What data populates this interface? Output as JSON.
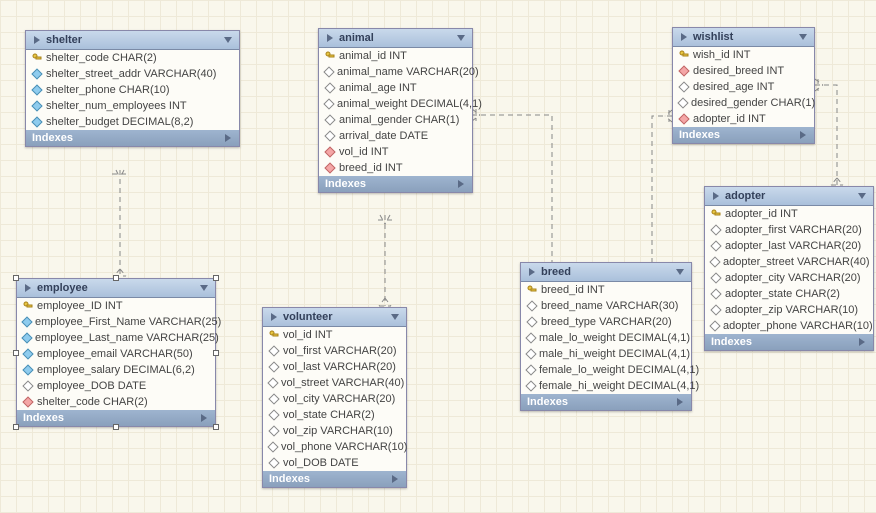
{
  "tables": {
    "shelter": {
      "title": "shelter",
      "columns": [
        {
          "icon": "key",
          "label": "shelter_code CHAR(2)"
        },
        {
          "icon": "blue",
          "label": "shelter_street_addr VARCHAR(40)"
        },
        {
          "icon": "blue",
          "label": "shelter_phone CHAR(10)"
        },
        {
          "icon": "blue",
          "label": "shelter_num_employees INT"
        },
        {
          "icon": "blue",
          "label": "shelter_budget DECIMAL(8,2)"
        }
      ],
      "footer": "Indexes"
    },
    "employee": {
      "title": "employee",
      "columns": [
        {
          "icon": "key",
          "label": "employee_ID INT"
        },
        {
          "icon": "blue",
          "label": "employee_First_Name VARCHAR(25)"
        },
        {
          "icon": "blue",
          "label": "employee_Last_name VARCHAR(25)"
        },
        {
          "icon": "blue",
          "label": "employee_email VARCHAR(50)"
        },
        {
          "icon": "blue",
          "label": "employee_salary DECIMAL(6,2)"
        },
        {
          "icon": "open",
          "label": "employee_DOB DATE"
        },
        {
          "icon": "red",
          "label": "shelter_code CHAR(2)"
        }
      ],
      "footer": "Indexes"
    },
    "animal": {
      "title": "animal",
      "columns": [
        {
          "icon": "key",
          "label": "animal_id INT"
        },
        {
          "icon": "open",
          "label": "animal_name VARCHAR(20)"
        },
        {
          "icon": "open",
          "label": "animal_age INT"
        },
        {
          "icon": "open",
          "label": "animal_weight DECIMAL(4,1)"
        },
        {
          "icon": "open",
          "label": "animal_gender CHAR(1)"
        },
        {
          "icon": "open",
          "label": "arrival_date DATE"
        },
        {
          "icon": "red",
          "label": "vol_id INT"
        },
        {
          "icon": "red",
          "label": "breed_id INT"
        }
      ],
      "footer": "Indexes"
    },
    "volunteer": {
      "title": "volunteer",
      "columns": [
        {
          "icon": "key",
          "label": "vol_id INT"
        },
        {
          "icon": "open",
          "label": "vol_first VARCHAR(20)"
        },
        {
          "icon": "open",
          "label": "vol_last VARCHAR(20)"
        },
        {
          "icon": "open",
          "label": "vol_street VARCHAR(40)"
        },
        {
          "icon": "open",
          "label": "vol_city VARCHAR(20)"
        },
        {
          "icon": "open",
          "label": "vol_state CHAR(2)"
        },
        {
          "icon": "open",
          "label": "vol_zip VARCHAR(10)"
        },
        {
          "icon": "open",
          "label": "vol_phone VARCHAR(10)"
        },
        {
          "icon": "open",
          "label": "vol_DOB DATE"
        }
      ],
      "footer": "Indexes"
    },
    "breed": {
      "title": "breed",
      "columns": [
        {
          "icon": "key",
          "label": "breed_id INT"
        },
        {
          "icon": "open",
          "label": "breed_name VARCHAR(30)"
        },
        {
          "icon": "open",
          "label": "breed_type VARCHAR(20)"
        },
        {
          "icon": "open",
          "label": "male_lo_weight DECIMAL(4,1)"
        },
        {
          "icon": "open",
          "label": "male_hi_weight DECIMAL(4,1)"
        },
        {
          "icon": "open",
          "label": "female_lo_weight DECIMAL(4,1)"
        },
        {
          "icon": "open",
          "label": "female_hi_weight DECIMAL(4,1)"
        }
      ],
      "footer": "Indexes"
    },
    "wishlist": {
      "title": "wishlist",
      "columns": [
        {
          "icon": "key",
          "label": "wish_id INT"
        },
        {
          "icon": "red",
          "label": "desired_breed INT"
        },
        {
          "icon": "open",
          "label": "desired_age INT"
        },
        {
          "icon": "open",
          "label": "desired_gender CHAR(1)"
        },
        {
          "icon": "red",
          "label": "adopter_id INT"
        }
      ],
      "footer": "Indexes"
    },
    "adopter": {
      "title": "adopter",
      "columns": [
        {
          "icon": "key",
          "label": "adopter_id INT"
        },
        {
          "icon": "open",
          "label": "adopter_first VARCHAR(20)"
        },
        {
          "icon": "open",
          "label": "adopter_last VARCHAR(20)"
        },
        {
          "icon": "open",
          "label": "adopter_street VARCHAR(40)"
        },
        {
          "icon": "open",
          "label": "adopter_city VARCHAR(20)"
        },
        {
          "icon": "open",
          "label": "adopter_state CHAR(2)"
        },
        {
          "icon": "open",
          "label": "adopter_zip VARCHAR(10)"
        },
        {
          "icon": "open",
          "label": "adopter_phone VARCHAR(10)"
        }
      ],
      "footer": "Indexes"
    }
  },
  "chart_data": {
    "type": "table",
    "title": "Entity-Relationship Diagram (animal shelter schema)",
    "entities": [
      "shelter",
      "employee",
      "animal",
      "volunteer",
      "breed",
      "wishlist",
      "adopter"
    ],
    "relationships": [
      {
        "from": "employee.shelter_code",
        "to": "shelter.shelter_code",
        "cardinality": "many-to-one"
      },
      {
        "from": "animal.vol_id",
        "to": "volunteer.vol_id",
        "cardinality": "many-to-one"
      },
      {
        "from": "animal.breed_id",
        "to": "breed.breed_id",
        "cardinality": "many-to-one"
      },
      {
        "from": "wishlist.desired_breed",
        "to": "breed.breed_id",
        "cardinality": "many-to-one"
      },
      {
        "from": "wishlist.adopter_id",
        "to": "adopter.adopter_id",
        "cardinality": "many-to-one"
      }
    ]
  }
}
